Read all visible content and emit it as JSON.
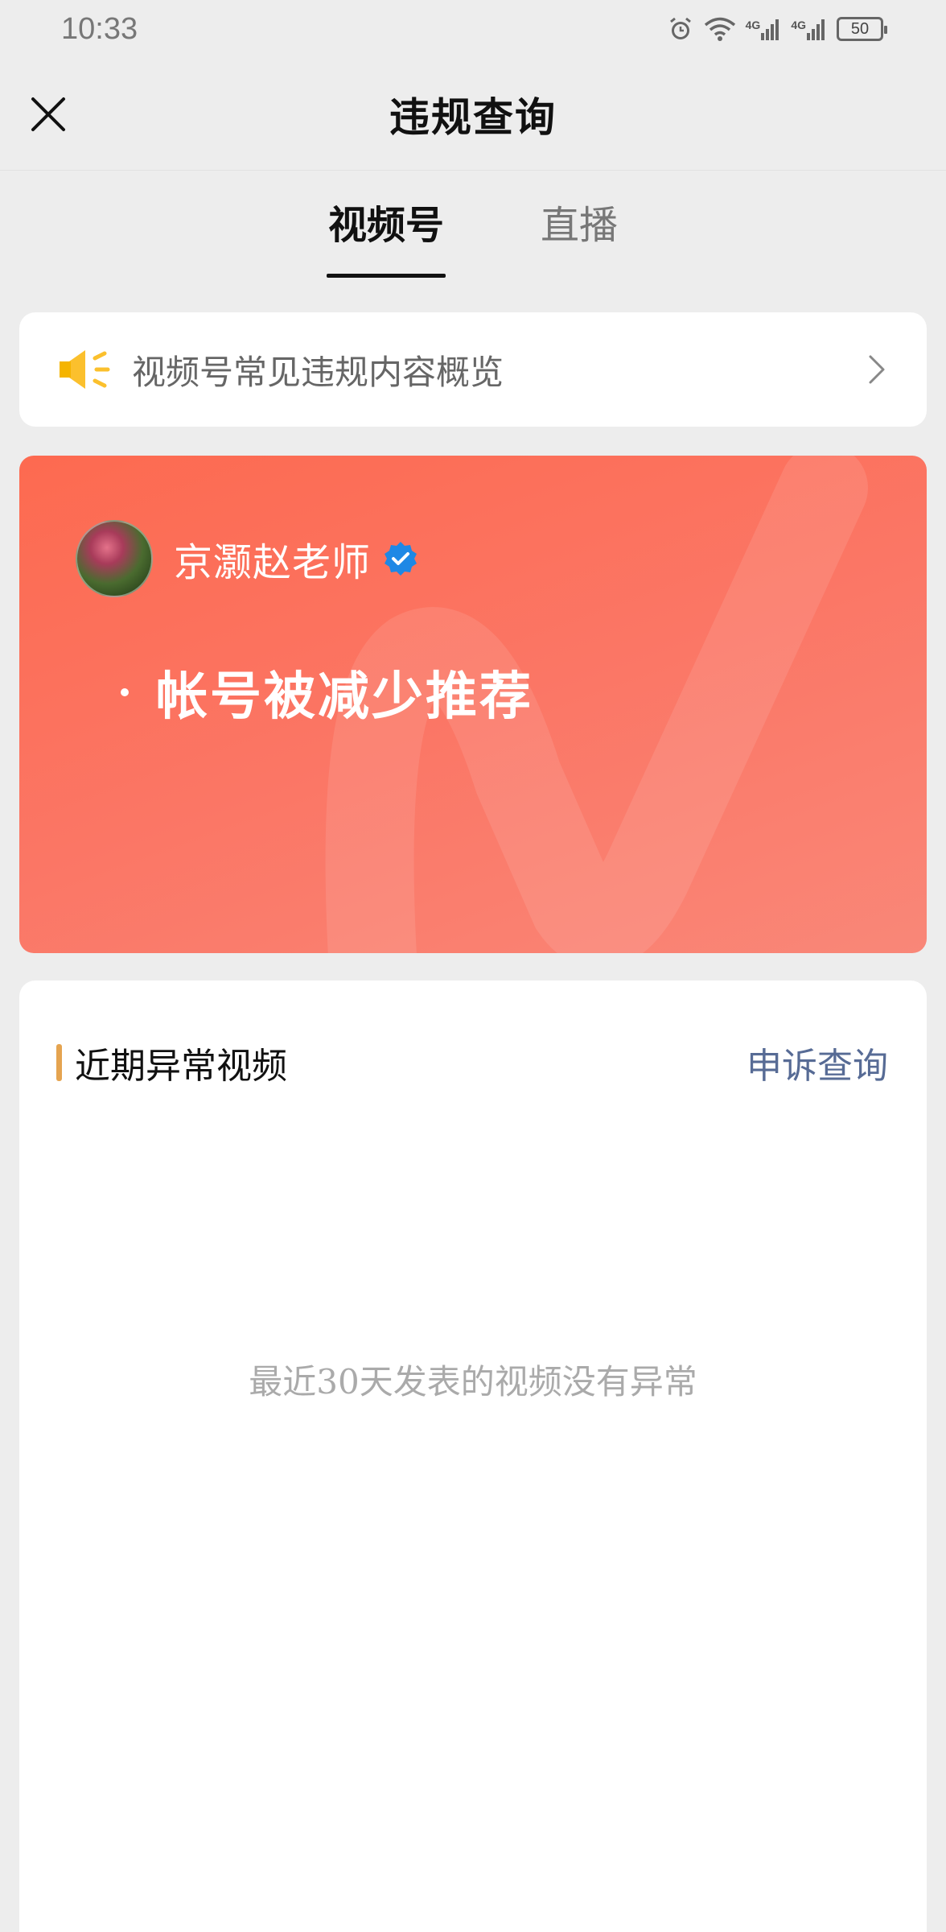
{
  "status_bar": {
    "time": "10:33",
    "network_1": "4G",
    "network_2": "4G",
    "battery": "50"
  },
  "nav": {
    "title": "违规查询"
  },
  "tabs": [
    {
      "label": "视频号",
      "active": true
    },
    {
      "label": "直播",
      "active": false
    }
  ],
  "notice": {
    "text": "视频号常见违规内容概览",
    "icon": "speaker-icon",
    "accent": "#fbc02d"
  },
  "account": {
    "name": "京灏赵老师",
    "verified": true,
    "penalty": "帐号被减少推荐",
    "card_color": "#fc6f57"
  },
  "recent": {
    "title": "近期异常视频",
    "appeal_link": "申诉查询",
    "empty_text": "最近30天发表的视频没有异常",
    "bar_color": "#e5a450",
    "link_color": "#576b95"
  }
}
